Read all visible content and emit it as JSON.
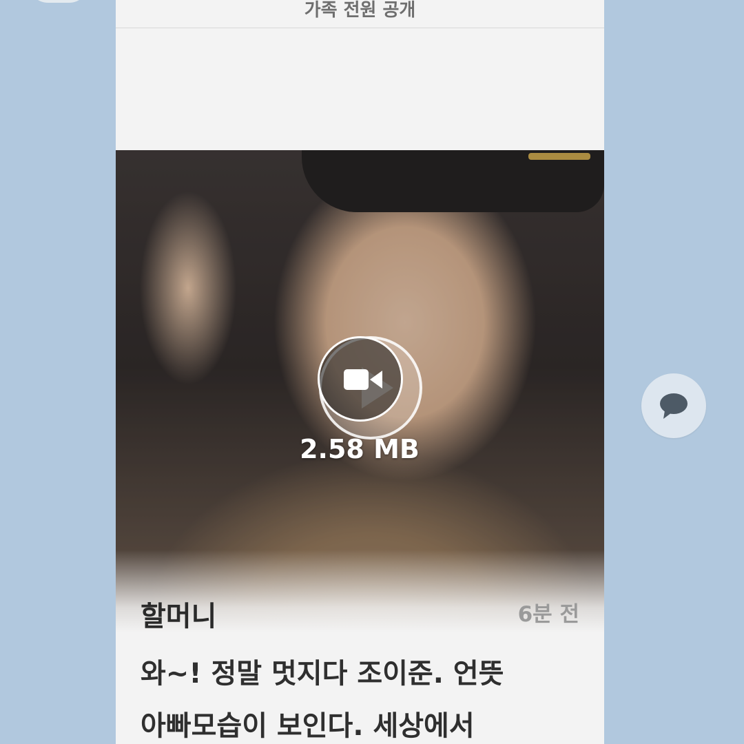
{
  "header": {
    "privacy": "가족 전원 공개"
  },
  "media": {
    "file_size": "2.58 MB",
    "icon": "video-camera-icon"
  },
  "post": {
    "author": "할머니",
    "time": "6분 전",
    "message_lines": [
      "와~! 정말 멋지다 조이준. 언뜻",
      "아빠모습이 보인다.  세상에서"
    ]
  },
  "actions": {
    "comment_icon": "speech-bubble-icon"
  },
  "colors": {
    "background": "#b1c8de",
    "card": "#f3f3f3",
    "comment_button": "#dde6ef"
  }
}
